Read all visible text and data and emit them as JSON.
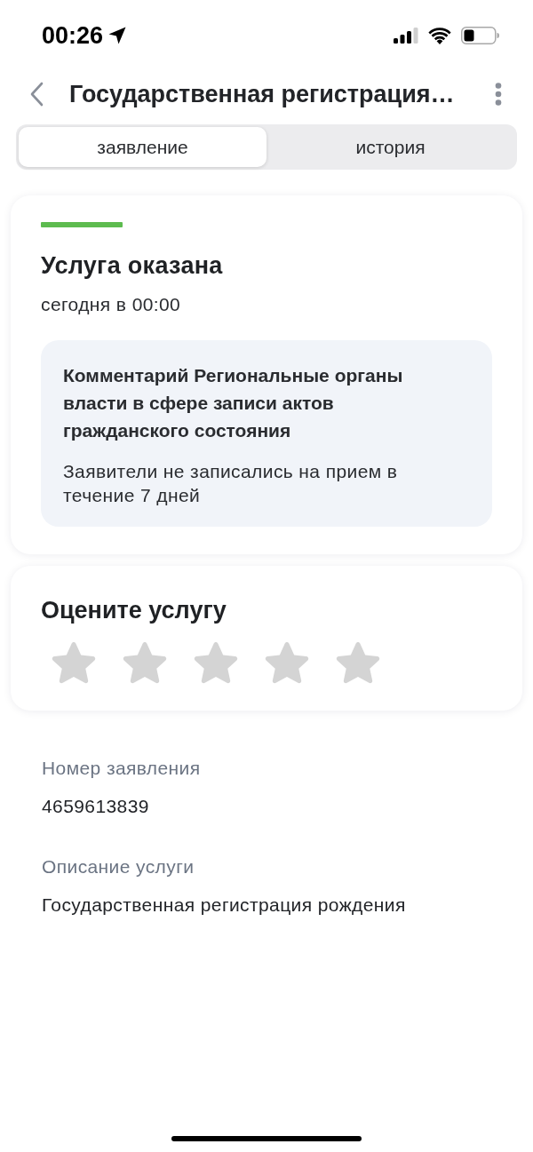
{
  "status_bar": {
    "time": "00:26"
  },
  "header": {
    "title": "Государственная регистрация…"
  },
  "tabs": [
    {
      "label": "заявление",
      "selected": true
    },
    {
      "label": "история",
      "selected": false
    }
  ],
  "status_card": {
    "title": "Услуга оказана",
    "time": "сегодня в 00:00",
    "comment": {
      "title": "Комментарий Региональные органы власти в сфере записи актов гражданского состояния",
      "text": "Заявители не записались на прием в течение 7 дней"
    }
  },
  "rating": {
    "title": "Оцените услугу",
    "stars": 0
  },
  "details": [
    {
      "label": "Номер заявления",
      "value": "4659613839"
    },
    {
      "label": "Описание услуги",
      "value": "Государственная регистрация рождения"
    }
  ]
}
